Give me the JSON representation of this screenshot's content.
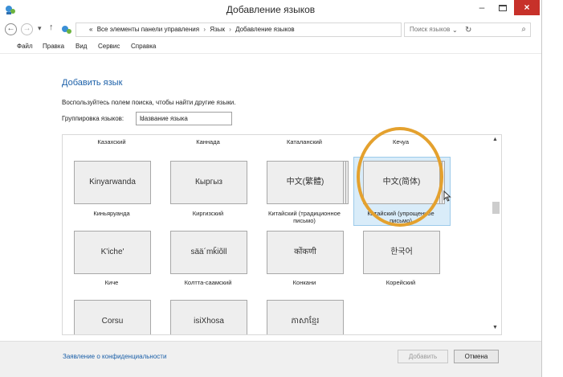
{
  "window": {
    "title": "Добавление языков",
    "minimize": "–",
    "close": "×"
  },
  "nav": {
    "back": "←",
    "forward": "→",
    "dropdown": "▾",
    "up": "↑"
  },
  "breadcrumb": [
    "«",
    "Все элементы панели управления",
    "Язык",
    "Добавление языков"
  ],
  "breadcrumb_sep": "›",
  "address": {
    "dropdown": "⌄",
    "refresh": "↻"
  },
  "search": {
    "placeholder": "Поиск языков",
    "icon": "⌕"
  },
  "menu": [
    "Файл",
    "Правка",
    "Вид",
    "Сервис",
    "Справка"
  ],
  "content": {
    "heading": "Добавить язык",
    "instruction": "Воспользуйтесь полем поиска, чтобы найти другие языки.",
    "group_label": "Группировка языков:",
    "group_value": "Название языка",
    "group_arrow": "⌄"
  },
  "top_captions": [
    "Казахский",
    "Каннада",
    "Каталанский",
    "Кечуа"
  ],
  "tiles": [
    {
      "box": "Kinyarwanda",
      "caption": [
        "Киньяруанда"
      ]
    },
    {
      "box": "Кыргыз",
      "caption": [
        "Киргизский"
      ]
    },
    {
      "box": "中文(繁體)",
      "caption": [
        "Китайский (традиционное",
        "письмо)"
      ]
    },
    {
      "box": "中文(简体)",
      "caption": [
        "Китайский (упрощенное",
        "письмо)"
      ]
    },
    {
      "box": "K'iche'",
      "caption": [
        "Киче"
      ]
    },
    {
      "box": "sää´mǩiõll",
      "caption": [
        "Колтта-саамский"
      ]
    },
    {
      "box": "कोंकणी",
      "caption": [
        "Конкани"
      ]
    },
    {
      "box": "한국어",
      "caption": [
        "Корейский"
      ]
    },
    {
      "box": "Corsu",
      "caption": [
        ""
      ]
    },
    {
      "box": "isiXhosa",
      "caption": [
        ""
      ]
    },
    {
      "box": "ភាសាខ្មែរ",
      "caption": [
        ""
      ]
    }
  ],
  "scroll": {
    "up": "▲",
    "down": "▼"
  },
  "footer": {
    "privacy": "Заявление о конфиденциальности",
    "add": "Добавить",
    "cancel": "Отмена"
  },
  "colors": {
    "accent": "#1a5fa8",
    "highlight_ring": "#e4a12e",
    "close": "#c7312a",
    "selection": "#d9ecf9"
  }
}
